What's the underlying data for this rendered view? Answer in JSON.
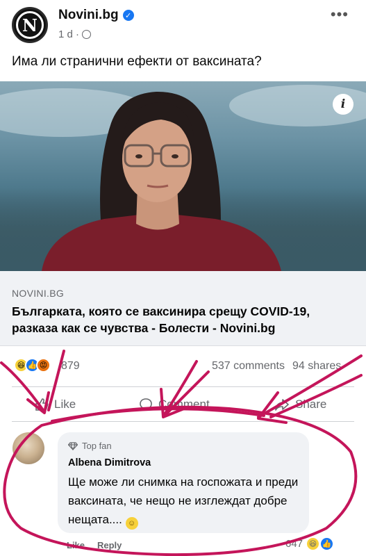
{
  "post": {
    "page_name": "Novini.bg",
    "logo_letter": "N",
    "time": "1 d ·",
    "more": "•••",
    "caption": "Има ли странични ефекти от ваксината?"
  },
  "link_preview": {
    "info_glyph": "i",
    "domain": "NOVINI.BG",
    "title": "Българката, която се ваксинира срещу COVID-19, разказа как се чувства - Болести - Novini.bg"
  },
  "stats": {
    "reactions_count": "879",
    "comments": "537 comments",
    "shares": "94 shares"
  },
  "actions": {
    "like": "Like",
    "comment": "Comment",
    "share": "Share"
  },
  "comment": {
    "badge": "Top fan",
    "author": "Albena Dimitrova",
    "text": "Ще може ли снимка на госпожата и преди ваксината, че нещо не изглеждат добре нещата....",
    "like_label": "Like",
    "reply_label": "Reply",
    "reactions_count": "647"
  },
  "colors": {
    "annotation": "#c4155a",
    "facebook_blue": "#1877f2",
    "muted_text": "#65676b",
    "bubble_bg": "#f0f2f5"
  }
}
